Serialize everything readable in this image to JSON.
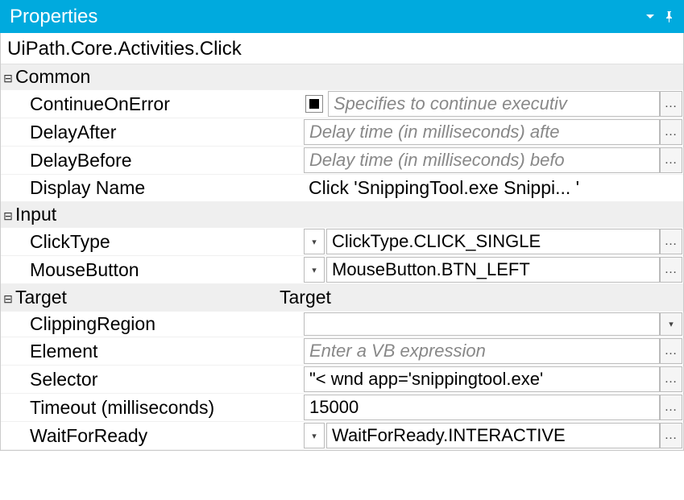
{
  "titlebar": {
    "title": "Properties"
  },
  "objectName": "UiPath.Core.Activities.Click",
  "groups": {
    "common": "Common",
    "input": "Input",
    "target": "Target"
  },
  "rows": {
    "continueOnError": {
      "label": "ContinueOnError",
      "placeholder": "Specifies to continue executiv"
    },
    "delayAfter": {
      "label": "DelayAfter",
      "placeholder": "Delay time (in milliseconds) afte"
    },
    "delayBefore": {
      "label": "DelayBefore",
      "placeholder": "Delay time (in milliseconds) befo"
    },
    "displayName": {
      "label": "Display Name",
      "value": "Click 'SnippingTool.exe Snippi... '"
    },
    "clickType": {
      "label": "ClickType",
      "value": "ClickType.CLICK_SINGLE"
    },
    "mouseButton": {
      "label": "MouseButton",
      "value": "MouseButton.BTN_LEFT"
    },
    "targetValue": {
      "value": "Target"
    },
    "clippingRegion": {
      "label": "ClippingRegion",
      "value": ""
    },
    "element": {
      "label": "Element",
      "placeholder": "Enter a VB expression"
    },
    "selector": {
      "label": "Selector",
      "value": "\"< wnd app='snippingtool.exe' "
    },
    "timeout": {
      "label": "Timeout (milliseconds)",
      "value": "15000"
    },
    "waitForReady": {
      "label": "WaitForReady",
      "value": "WaitForReady.INTERACTIVE"
    }
  },
  "glyphs": {
    "expanded": "⊟",
    "ellipsis": "…",
    "dropdown": "▾",
    "pin": "📌"
  }
}
